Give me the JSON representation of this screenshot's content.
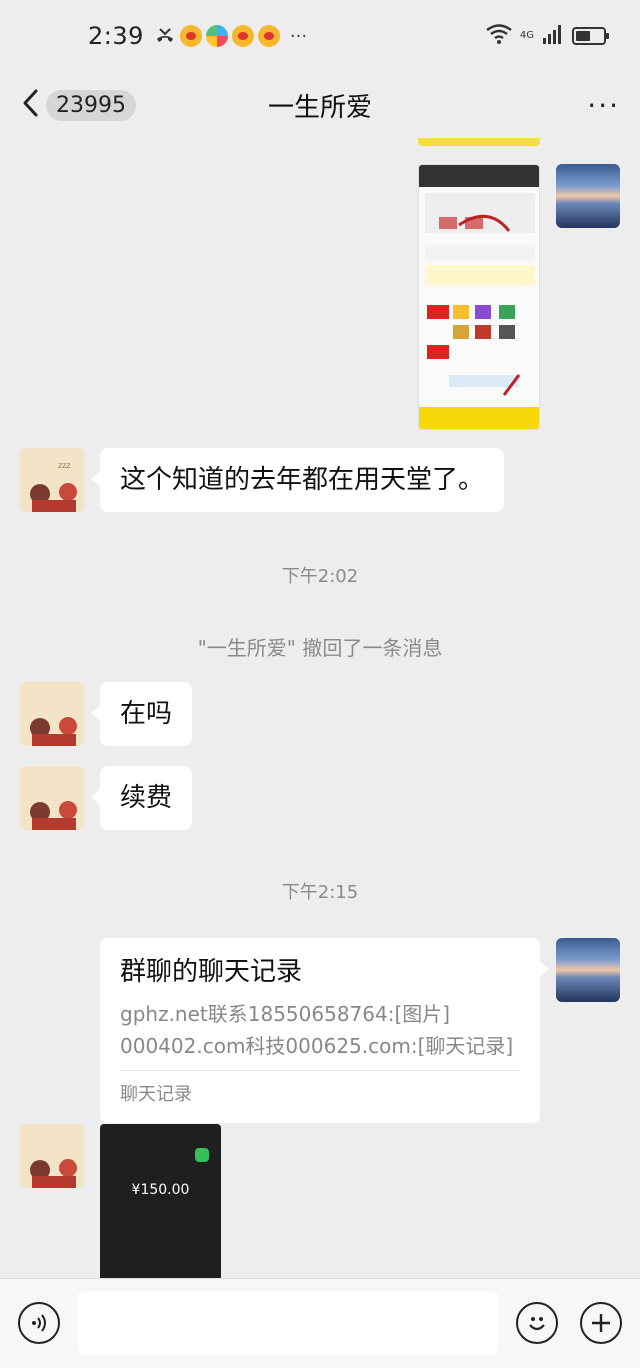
{
  "status_bar": {
    "time": "2:39",
    "more": "···",
    "network_label": "4G"
  },
  "header": {
    "unread_count": "23995",
    "title": "一生所爱",
    "more": "···"
  },
  "messages": {
    "m1_text": "这个知道的去年都在用天堂了。",
    "ts1": "下午2:02",
    "recall_notice": "\"一生所爱\" 撤回了一条消息",
    "m2_text": "在吗",
    "m3_text": "续费",
    "ts2": "下午2:15",
    "record": {
      "title": "群聊的聊天记录",
      "line1": "gphz.net联系18550658764:[图片]",
      "line2": "000402.com科技000625.com:[聊天记录]",
      "footer": "聊天记录"
    },
    "payment_amount": "¥150.00"
  },
  "input": {
    "placeholder": ""
  },
  "colors": {
    "background": "#ededed",
    "bubble": "#ffffff",
    "muted_text": "#8a8a8a",
    "pay_green": "#35c05a"
  }
}
